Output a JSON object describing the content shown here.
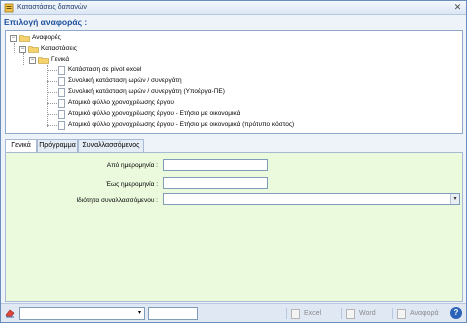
{
  "window": {
    "title": "Καταστάσεις δαπανών"
  },
  "reports_header": "Επιλογή αναφοράς :",
  "tree": {
    "root": "Αναφορές",
    "level1": "Καταστάσεις",
    "level2": "Γενικά",
    "items": [
      "Κατάσταση σε pivot excel",
      "Συνολική κατάσταση ωρών / συνεργάτη",
      "Συνολική κατάσταση ωρών / συνεργάτη (Υποέργα-ΠΕ)",
      "Ατομικό φύλλο χρονοχρέωσης έργου",
      "Ατομικό φύλλο χρονοχρέωσης έργου - Ετήσιο με οικονομικά",
      "Ατομικό φύλλο χρονοχρέωσης έργου - Ετήσιο με οικονομικά (πρότυπο κόστος)"
    ]
  },
  "tabs": [
    "Γενικά",
    "Πρόγραμμα",
    "Συναλλασσόμενος"
  ],
  "form": {
    "from_date_label": "Από ημερομηνία :",
    "from_date_value": "",
    "to_date_label": "Έως ημερομηνία :",
    "to_date_value": "",
    "property_label": "Ιδιότητα συναλλασσόμενου :",
    "property_value": ""
  },
  "statusbar": {
    "excel_label": "Excel",
    "word_label": "Word",
    "report_label": "Αναφορά",
    "help_label": "?"
  },
  "colors": {
    "accent": "#1e4f9c",
    "form_bg": "#ebf9dd",
    "border": "#8ea8cc"
  }
}
